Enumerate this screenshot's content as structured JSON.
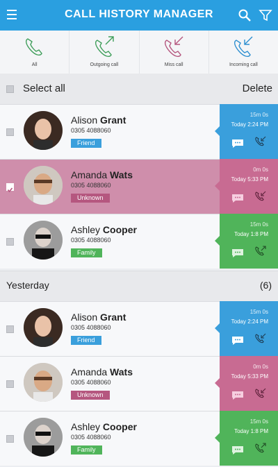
{
  "header": {
    "title": "CALL HISTORY  MANAGER",
    "menu_icon": "hamburger-menu-icon",
    "search_icon": "search-icon",
    "filter_icon": "filter-icon"
  },
  "filters": [
    {
      "label": "All",
      "icon": "phone-icon"
    },
    {
      "label": "Outgoing call",
      "icon": "outgoing-call-icon"
    },
    {
      "label": "Miss call",
      "icon": "missed-call-icon"
    },
    {
      "label": "Incoming call",
      "icon": "incoming-call-icon"
    }
  ],
  "list_header": {
    "select_all": "Select all",
    "delete": "Delete"
  },
  "colors": {
    "blue": "#3a9fdc",
    "pink": "#c86b92",
    "green": "#50b45a",
    "header": "#2a9fe0"
  },
  "calls": [
    {
      "first": "Alison",
      "last": "Grant",
      "phone": "0305 4088060",
      "tag": "Friend",
      "duration": "15m 0s",
      "time": "Today  2:24 PM",
      "type": "incoming",
      "selected": false
    },
    {
      "first": "Amanda",
      "last": "Wats",
      "phone": "0305 4088060",
      "tag": "Unknown",
      "duration": "0m 0s",
      "time": "Today  5:33 PM",
      "type": "missed",
      "selected": true
    },
    {
      "first": "Ashley",
      "last": "Cooper",
      "phone": "0305 4088060",
      "tag": "Family",
      "duration": "15m 0s",
      "time": "Today  1:8 PM",
      "type": "outgoing",
      "selected": false
    }
  ],
  "section": {
    "title": "Yesterday",
    "count": "(6)"
  },
  "yesterday_calls": [
    {
      "first": "Alison",
      "last": "Grant",
      "phone": "0305 4088060",
      "tag": "Friend",
      "duration": "15m 0s",
      "time": "Today  2:24 PM",
      "type": "incoming",
      "selected": false
    },
    {
      "first": "Amanda",
      "last": "Wats",
      "phone": "0305 4088060",
      "tag": "Unknown",
      "duration": "0m 0s",
      "time": "Today  5:33 PM",
      "type": "missed",
      "selected": false
    },
    {
      "first": "Ashley",
      "last": "Cooper",
      "phone": "0305 4088060",
      "tag": "Family",
      "duration": "15m 0s",
      "time": "Today  1:8 PM",
      "type": "outgoing",
      "selected": false
    }
  ]
}
